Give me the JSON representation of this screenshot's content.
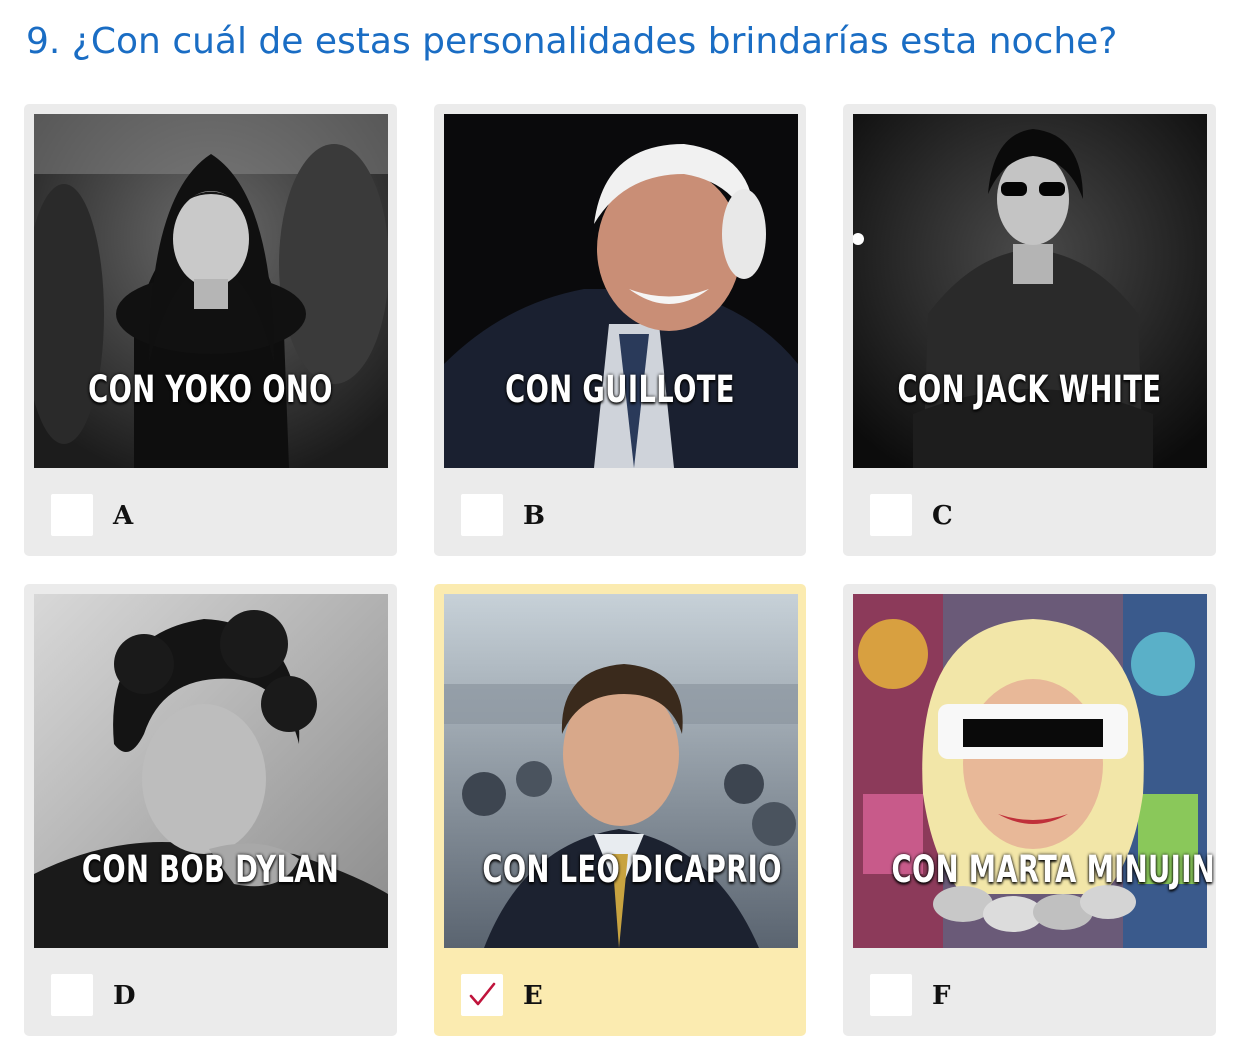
{
  "question": {
    "title": "9. ¿Con cuál de estas personalidades brindarías esta noche?"
  },
  "colors": {
    "title": "#1a6dc4",
    "card_background": "#ebebeb",
    "card_selected_background": "#fbebb0",
    "checkmark": "#c0143c"
  },
  "options": [
    {
      "letter": "A",
      "caption": "CON YOKO ONO",
      "selected": false
    },
    {
      "letter": "B",
      "caption": "CON GUILLOTE",
      "selected": false
    },
    {
      "letter": "C",
      "caption": "CON JACK WHITE",
      "selected": false
    },
    {
      "letter": "D",
      "caption": "CON BOB DYLAN",
      "selected": false
    },
    {
      "letter": "E",
      "caption": "CON LEO DICAPRIO",
      "selected": true
    },
    {
      "letter": "F",
      "caption": "CON MARTA MINUJIN",
      "selected": false
    }
  ],
  "icons": {
    "selected_check": "checkmark-icon"
  }
}
